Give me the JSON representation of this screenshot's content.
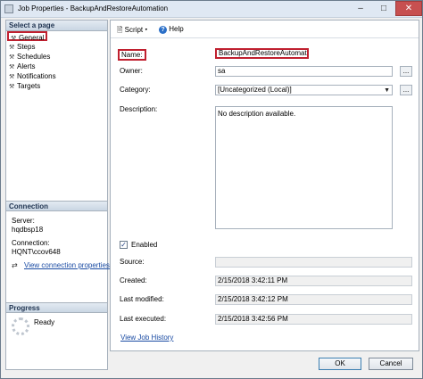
{
  "window": {
    "title": "Job Properties - BackupAndRestoreAutomation"
  },
  "left": {
    "select_page_header": "Select a page",
    "pages": [
      "General",
      "Steps",
      "Schedules",
      "Alerts",
      "Notifications",
      "Targets"
    ],
    "connection_header": "Connection",
    "server_label": "Server:",
    "server_value": "hqdbsp18",
    "connection_label": "Connection:",
    "connection_value": "HQNT\\ccov648",
    "view_connection_link": "View connection properties",
    "progress_header": "Progress",
    "progress_status": "Ready"
  },
  "toolbar": {
    "script_label": "Script",
    "help_label": "Help"
  },
  "form": {
    "name_label": "Name:",
    "name_value": "BackupAndRestoreAutomation",
    "owner_label": "Owner:",
    "owner_value": "sa",
    "category_label": "Category:",
    "category_value": "[Uncategorized (Local)]",
    "description_label": "Description:",
    "description_value": "No description available.",
    "enabled_label": "Enabled",
    "source_label": "Source:",
    "created_label": "Created:",
    "created_value": "2/15/2018 3:42:11 PM",
    "last_modified_label": "Last modified:",
    "last_modified_value": "2/15/2018 3:42:12 PM",
    "last_executed_label": "Last executed:",
    "last_executed_value": "2/15/2018 3:42:56 PM",
    "view_history_link": "View Job History",
    "ellipsis": "..."
  },
  "buttons": {
    "ok": "OK",
    "cancel": "Cancel"
  }
}
